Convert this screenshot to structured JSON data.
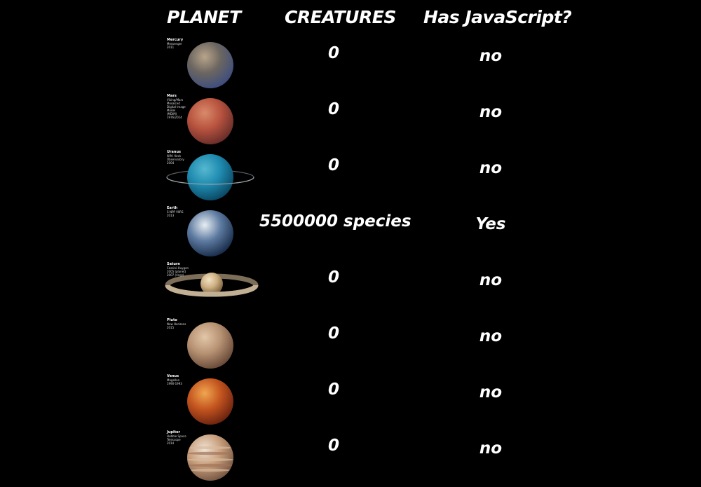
{
  "headers": {
    "planet": "PLANET",
    "creatures": "CREATURES",
    "has_js": "Has JavaScript?"
  },
  "rows": [
    {
      "planet": "Mercury",
      "caption": [
        "Messenger",
        "2011"
      ],
      "creatures": "0",
      "has_js": "no",
      "icon": "mercury-icon",
      "colors": [
        "#b9a48a",
        "#6b6660",
        "#3f4e7d"
      ]
    },
    {
      "planet": "Mars",
      "caption": [
        "Viking/Mars Mosaiced",
        "Digital Image Model",
        "(MDIM)",
        "1976/2014"
      ],
      "creatures": "0",
      "has_js": "no",
      "icon": "mars-icon",
      "colors": [
        "#d98a6a",
        "#b8533f",
        "#6a2e2a"
      ]
    },
    {
      "planet": "Uranus",
      "caption": [
        "W.M. Keck Observatory",
        "2004"
      ],
      "creatures": "0",
      "has_js": "no",
      "icon": "uranus-icon",
      "colors": [
        "#56b8d0",
        "#1f8bb0",
        "#0b4a66"
      ]
    },
    {
      "planet": "Earth",
      "caption": [
        "S-NPP VIIRS",
        "2013"
      ],
      "creatures": "5500000 species",
      "has_js": "Yes",
      "icon": "earth-icon",
      "colors": [
        "#e8eef2",
        "#5d7aa0",
        "#1b2f4d"
      ]
    },
    {
      "planet": "Saturn",
      "caption": [
        "Cassini-Huygen",
        "2005 (planet)",
        "2007 (rings)"
      ],
      "creatures": "0",
      "has_js": "no",
      "icon": "saturn-icon",
      "colors": [
        "#f2e2c2",
        "#cdb084",
        "#7a5f3a"
      ]
    },
    {
      "planet": "Pluto",
      "caption": [
        "New Horizons",
        "2015"
      ],
      "creatures": "0",
      "has_js": "no",
      "icon": "pluto-icon",
      "colors": [
        "#e2c7a8",
        "#b79273",
        "#6b4c3a"
      ]
    },
    {
      "planet": "Venus",
      "caption": [
        "Magellan",
        "1990-1993"
      ],
      "creatures": "0",
      "has_js": "no",
      "icon": "venus-icon",
      "colors": [
        "#f0a650",
        "#c4551f",
        "#6e2410"
      ]
    },
    {
      "planet": "Jupiter",
      "caption": [
        "Hubble Space",
        "Telescope",
        "2014"
      ],
      "creatures": "0",
      "has_js": "no",
      "icon": "jupiter-icon",
      "colors": [
        "#efe4d6",
        "#c89f7c",
        "#7a5a45"
      ]
    }
  ]
}
